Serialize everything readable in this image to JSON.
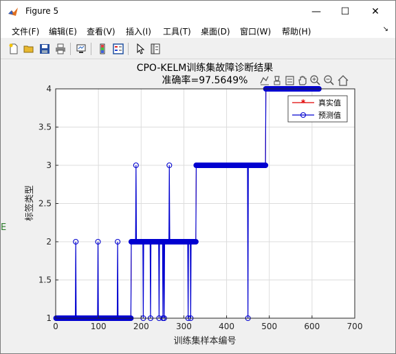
{
  "window": {
    "title": "Figure 5",
    "minimize_glyph": "—",
    "maximize_glyph": "☐",
    "close_glyph": "✕"
  },
  "menu": [
    "文件(F)",
    "编辑(E)",
    "查看(V)",
    "插入(I)",
    "工具(T)",
    "桌面(D)",
    "窗口(W)",
    "帮助(H)"
  ],
  "toolbar_icons": [
    "new-figure-icon",
    "open-file-icon",
    "save-icon",
    "print-icon",
    "link-plot-icon",
    "insert-colorbar-icon",
    "insert-legend-icon",
    "select-arrow-icon",
    "property-inspector-icon"
  ],
  "axes_toolbar_icons": [
    "export-icon",
    "brush-icon",
    "data-tips-icon",
    "pan-hand-icon",
    "zoom-in-icon",
    "zoom-out-icon",
    "home-icon"
  ],
  "chart_data": {
    "type": "line",
    "title": "CPO-KELM训练集故障诊断结果",
    "subtitle": "准确率=97.5649%",
    "xlabel": "训练集样本编号",
    "ylabel": "标签类型",
    "xlim": [
      0,
      700
    ],
    "ylim": [
      1,
      4
    ],
    "xticks": [
      0,
      100,
      200,
      300,
      400,
      500,
      600,
      700
    ],
    "yticks": [
      1,
      1.5,
      2,
      2.5,
      3,
      3.5,
      4
    ],
    "ytick_labels": [
      "1",
      "1.5",
      "2",
      "2.5",
      "3",
      "3.5",
      "4"
    ],
    "grid": true,
    "legend_position": "top-right",
    "segments_true": [
      {
        "from": 1,
        "to": 176,
        "value": 1
      },
      {
        "from": 177,
        "to": 328,
        "value": 2
      },
      {
        "from": 329,
        "to": 491,
        "value": 3
      },
      {
        "from": 492,
        "to": 616,
        "value": 4
      }
    ],
    "series": [
      {
        "name": "真实值",
        "color": "#e00000",
        "marker": "*"
      },
      {
        "name": "预测值",
        "color": "#0000d0",
        "marker": "o"
      }
    ],
    "misclassified": [
      {
        "x": 47,
        "true": 1,
        "pred": 2
      },
      {
        "x": 99,
        "true": 1,
        "pred": 2
      },
      {
        "x": 145,
        "true": 1,
        "pred": 2
      },
      {
        "x": 188,
        "true": 2,
        "pred": 3
      },
      {
        "x": 205,
        "true": 2,
        "pred": 1
      },
      {
        "x": 222,
        "true": 2,
        "pred": 1
      },
      {
        "x": 242,
        "true": 2,
        "pred": 1
      },
      {
        "x": 251,
        "true": 2,
        "pred": 1
      },
      {
        "x": 254,
        "true": 2,
        "pred": 1
      },
      {
        "x": 266,
        "true": 2,
        "pred": 3
      },
      {
        "x": 310,
        "true": 2,
        "pred": 1
      },
      {
        "x": 316,
        "true": 2,
        "pred": 1
      },
      {
        "x": 450,
        "true": 3,
        "pred": 1
      }
    ]
  }
}
